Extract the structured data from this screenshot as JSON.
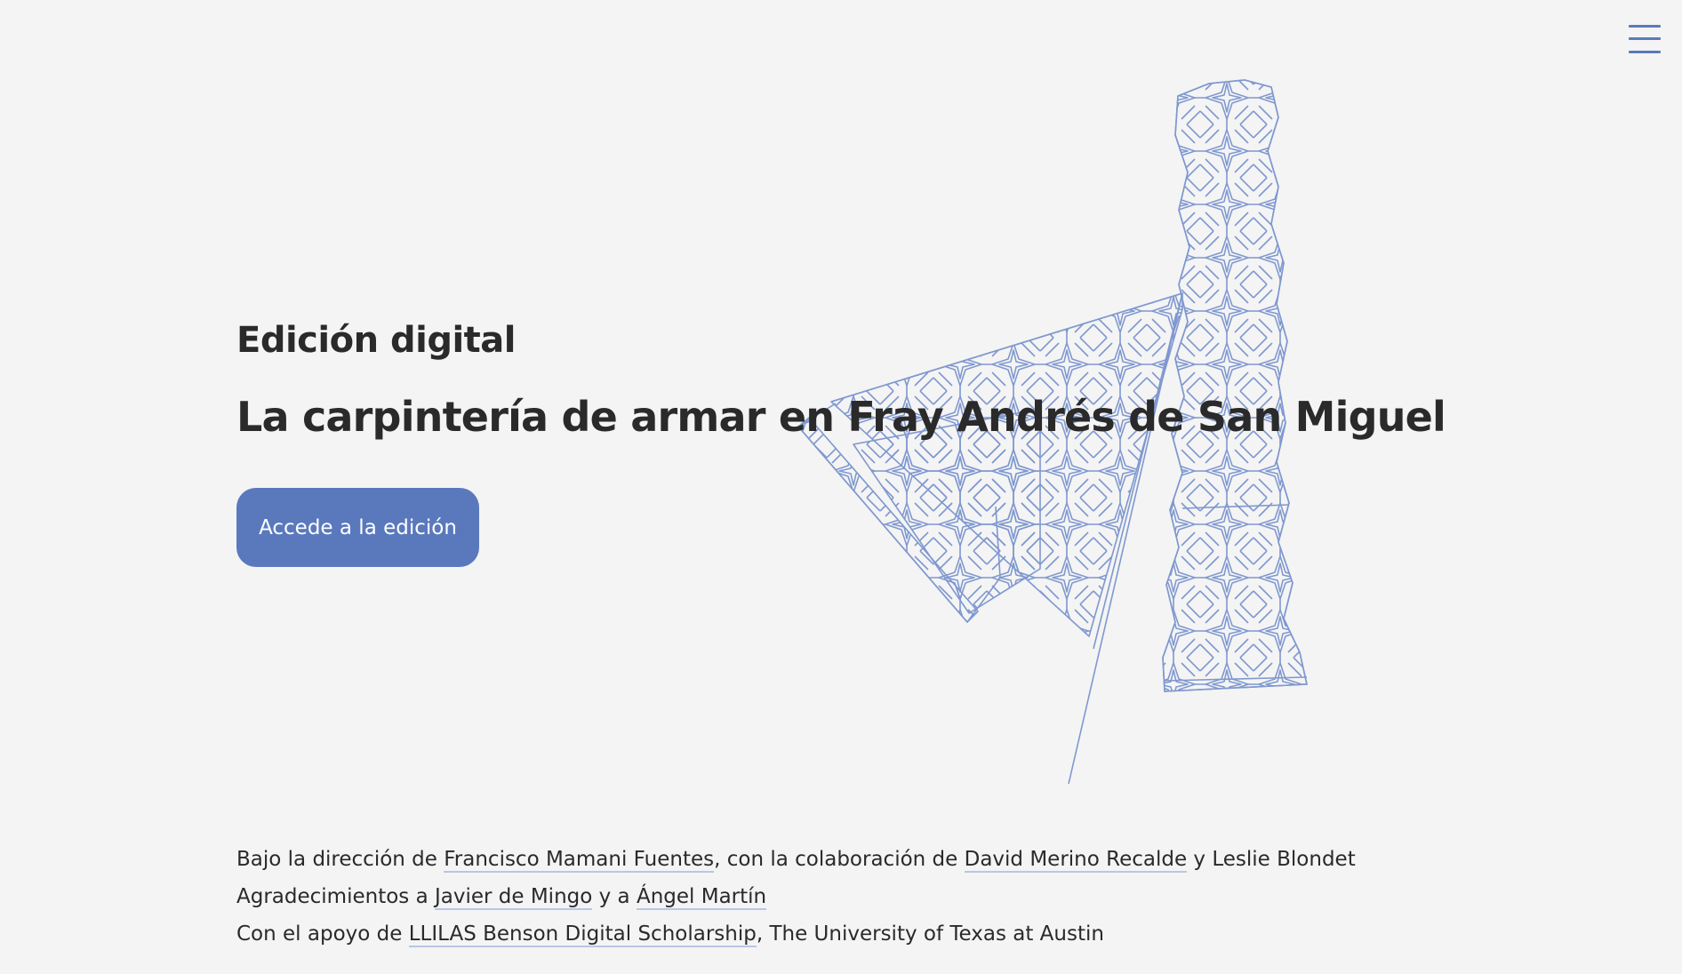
{
  "header": {
    "menu_icon": "hamburger-menu-icon",
    "accent_color": "#5a79bd"
  },
  "hero": {
    "eyebrow": "Edición digital",
    "title": "La carpintería de armar en Fray Andrés de San Miguel",
    "cta_label": "Accede a la edición",
    "art_icon": "lacework-geometric-illustration"
  },
  "credits": {
    "line1": {
      "prefix": "Bajo la dirección de ",
      "link1": "Francisco Mamani Fuentes",
      "middle": ", con la colaboración de ",
      "link2": "David Merino Recalde",
      "suffix": " y Leslie Blondet"
    },
    "line2": {
      "prefix": "Agradecimientos a ",
      "link1": "Javier de Mingo",
      "middle": " y a ",
      "link2": "Ángel Martín"
    },
    "line3": {
      "prefix": "Con el apoyo de ",
      "link1": "LLILAS Benson Digital Scholarship",
      "suffix": ", The University of Texas at Austin"
    }
  }
}
